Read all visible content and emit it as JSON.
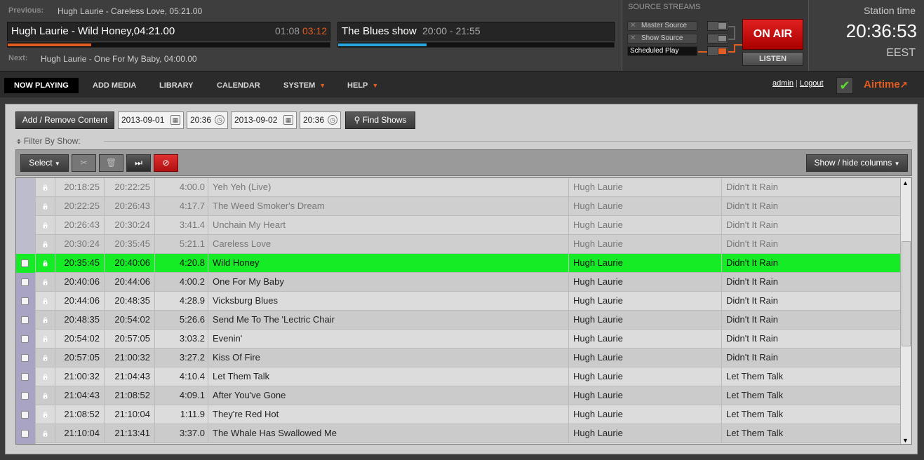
{
  "top": {
    "previous_label": "Previous:",
    "previous_value": "Hugh Laurie - Careless Love, 05:21.00",
    "now_playing": "Hugh Laurie - Wild Honey,04:21.00",
    "elapsed": "01:08",
    "remaining": "03:12",
    "progress": 0.26,
    "next_label": "Next:",
    "next_value": "Hugh Laurie - One For My Baby, 04:00.00",
    "show_name": "The Blues show",
    "show_time": "20:00 - 21:55",
    "show_progress": 0.32
  },
  "source": {
    "heading": "SOURCE STREAMS",
    "master": "Master Source",
    "show": "Show Source",
    "scheduled": "Scheduled Play",
    "on_air": "ON AIR",
    "listen": "LISTEN"
  },
  "station": {
    "label": "Station time",
    "time": "20:36:53",
    "tz": "EEST"
  },
  "nav": {
    "items": [
      "NOW PLAYING",
      "ADD MEDIA",
      "LIBRARY",
      "CALENDAR",
      "SYSTEM",
      "HELP"
    ],
    "user": "admin",
    "sep": " | ",
    "logout": "Logout",
    "logo": "Airtime"
  },
  "controls": {
    "add_remove": "Add / Remove Content",
    "start_date": "2013-09-01",
    "start_time": "20:36",
    "end_date": "2013-09-02",
    "end_time": "20:36",
    "find": "Find Shows",
    "filter": "Filter By Show:",
    "select": "Select",
    "show_hide": "Show / hide columns"
  },
  "colors": {
    "accent": "#e15d22",
    "current_row": "#16ec25",
    "on_air": "#d01010"
  },
  "rows": [
    {
      "start": "20:18:25",
      "end": "20:22:25",
      "len": "4:00.0",
      "title": "Yeh Yeh (Live)",
      "artist": "Hugh Laurie",
      "album": "Didn't It Rain",
      "state": "past"
    },
    {
      "start": "20:22:25",
      "end": "20:26:43",
      "len": "4:17.7",
      "title": "The Weed Smoker's Dream",
      "artist": "Hugh Laurie",
      "album": "Didn't It Rain",
      "state": "past"
    },
    {
      "start": "20:26:43",
      "end": "20:30:24",
      "len": "3:41.4",
      "title": "Unchain My Heart",
      "artist": "Hugh Laurie",
      "album": "Didn't It Rain",
      "state": "past"
    },
    {
      "start": "20:30:24",
      "end": "20:35:45",
      "len": "5:21.1",
      "title": "Careless Love",
      "artist": "Hugh Laurie",
      "album": "Didn't It Rain",
      "state": "past"
    },
    {
      "start": "20:35:45",
      "end": "20:40:06",
      "len": "4:20.8",
      "title": "Wild Honey",
      "artist": "Hugh Laurie",
      "album": "Didn't It Rain",
      "state": "current"
    },
    {
      "start": "20:40:06",
      "end": "20:44:06",
      "len": "4:00.2",
      "title": "One For My Baby",
      "artist": "Hugh Laurie",
      "album": "Didn't It Rain",
      "state": "future"
    },
    {
      "start": "20:44:06",
      "end": "20:48:35",
      "len": "4:28.9",
      "title": "Vicksburg Blues",
      "artist": "Hugh Laurie",
      "album": "Didn't It Rain",
      "state": "future"
    },
    {
      "start": "20:48:35",
      "end": "20:54:02",
      "len": "5:26.6",
      "title": "Send Me To The 'Lectric Chair",
      "artist": "Hugh Laurie",
      "album": "Didn't It Rain",
      "state": "future"
    },
    {
      "start": "20:54:02",
      "end": "20:57:05",
      "len": "3:03.2",
      "title": "Evenin'",
      "artist": "Hugh Laurie",
      "album": "Didn't It Rain",
      "state": "future"
    },
    {
      "start": "20:57:05",
      "end": "21:00:32",
      "len": "3:27.2",
      "title": "Kiss Of Fire",
      "artist": "Hugh Laurie",
      "album": "Didn't It Rain",
      "state": "future"
    },
    {
      "start": "21:00:32",
      "end": "21:04:43",
      "len": "4:10.4",
      "title": "Let Them Talk",
      "artist": "Hugh Laurie",
      "album": "Let Them Talk",
      "state": "future"
    },
    {
      "start": "21:04:43",
      "end": "21:08:52",
      "len": "4:09.1",
      "title": "After You've Gone",
      "artist": "Hugh Laurie",
      "album": "Let Them Talk",
      "state": "future"
    },
    {
      "start": "21:08:52",
      "end": "21:10:04",
      "len": "1:11.9",
      "title": "They're Red Hot",
      "artist": "Hugh Laurie",
      "album": "Let Them Talk",
      "state": "future"
    },
    {
      "start": "21:10:04",
      "end": "21:13:41",
      "len": "3:37.0",
      "title": "The Whale Has Swallowed Me",
      "artist": "Hugh Laurie",
      "album": "Let Them Talk",
      "state": "future"
    }
  ]
}
